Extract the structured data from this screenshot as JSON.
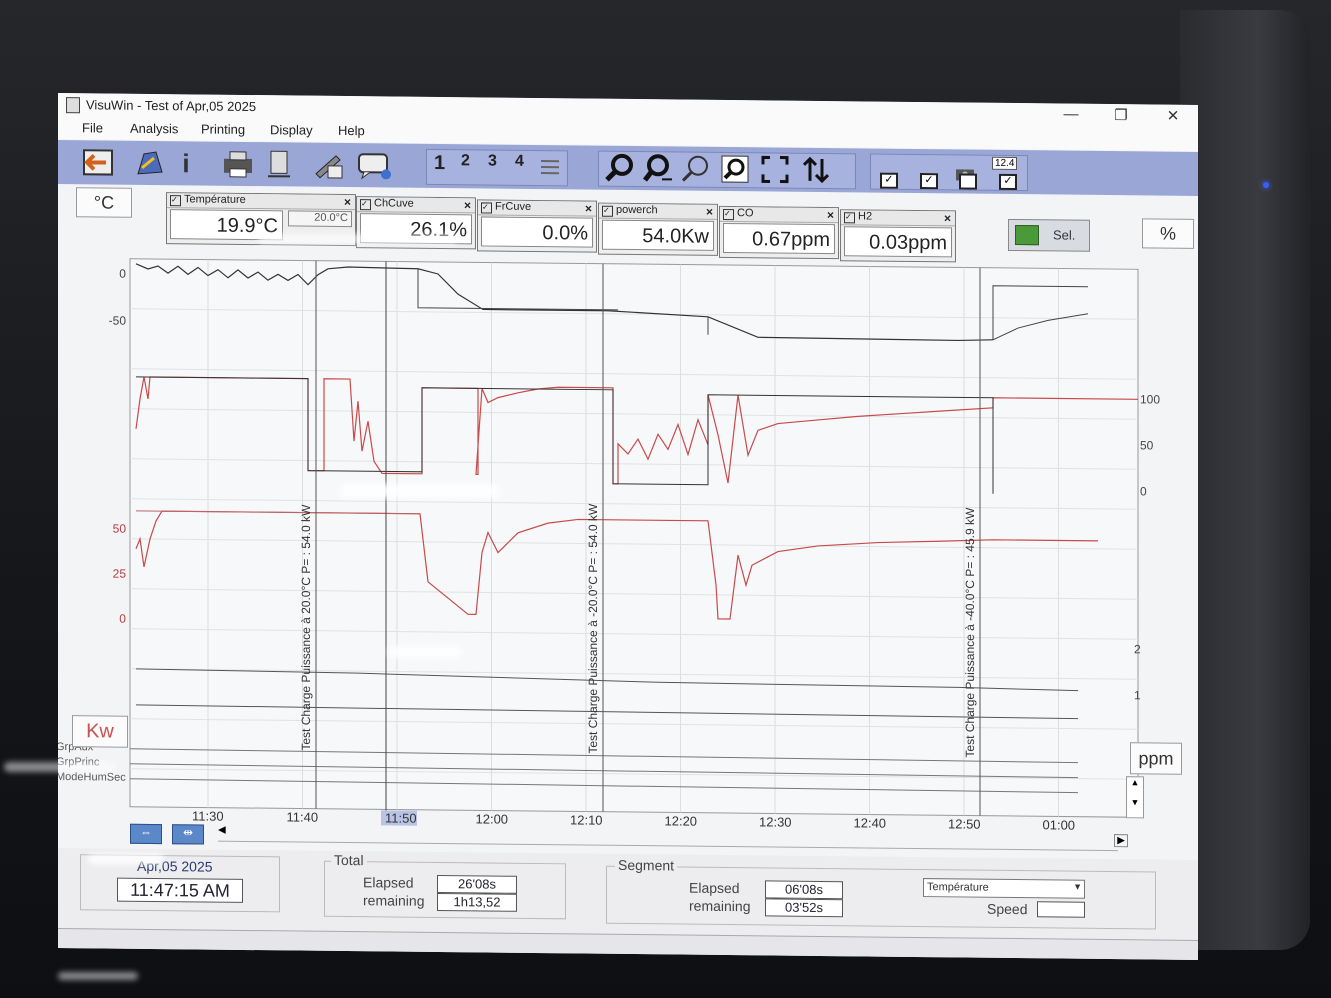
{
  "window": {
    "title": "VisuWin - Test of Apr,05 2025",
    "buttons": {
      "minimize": "—",
      "restore": "❐",
      "close": "✕"
    }
  },
  "menu": [
    "File",
    "Analysis",
    "Printing",
    "Display",
    "Help"
  ],
  "toolbar": {
    "pages": [
      "1",
      "2",
      "3",
      "4"
    ],
    "counter": "12.4",
    "icons": [
      "exit-icon",
      "open-icon",
      "info-icon",
      "print-icon",
      "page-icon",
      "edit-icon",
      "comment-icon",
      "zoom-icon",
      "zoom-out-icon",
      "zoom-in-icon",
      "zoom-window-icon",
      "fit-icon",
      "swap-icon",
      "camera-icon"
    ]
  },
  "units": {
    "left_top": "°C",
    "left_bottom": "Kw",
    "right_top": "%",
    "right_bottom": "ppm"
  },
  "sensors": [
    {
      "name": "Température",
      "value": "19.9°C",
      "setpoint": "20.0°C"
    },
    {
      "name": "ChCuve",
      "value": "26.1%"
    },
    {
      "name": "FrCuve",
      "value": "0.0%"
    },
    {
      "name": "powerch",
      "value": "54.0Kw"
    },
    {
      "name": "CO",
      "value": "0.67ppm"
    },
    {
      "name": "H2",
      "value": "0.03ppm"
    }
  ],
  "sel_button": "Sel.",
  "chart_data": {
    "type": "line",
    "y_ticks_temp": [
      "0",
      "-50"
    ],
    "y_ticks_percent": [
      "100",
      "50",
      "0"
    ],
    "y_ticks_power": [
      "50",
      "25",
      "0"
    ],
    "y_ticks_ppm": [
      "2",
      "1"
    ],
    "row_labels": [
      "GrpAux",
      "GrpPrinc",
      "ModeHumSec"
    ],
    "x_ticks": [
      "11:30",
      "11:40",
      "11:50",
      "12:00",
      "12:10",
      "12:20",
      "12:30",
      "12:40",
      "12:50",
      "01:00"
    ],
    "annotations": [
      "Test Charge Puissance à 20.0°C  P= : 54.0 kW",
      "Test Charge Puissance à -20.0°C  P= : 54.0 kW",
      "Test Charge Puissance à -40.0°C  P= : 45.9 kW"
    ],
    "series": [
      {
        "name": "Température",
        "color": "#333333"
      },
      {
        "name": "ChCuve",
        "color": "#c84a4a"
      },
      {
        "name": "powerch",
        "color": "#c84a4a"
      }
    ]
  },
  "status": {
    "date": "Apr,05 2025",
    "time": "11:47:15 AM",
    "total_label": "Total",
    "segment_label": "Segment",
    "elapsed_label": "Elapsed",
    "remaining_label": "remaining",
    "total_elapsed": "26'08s",
    "total_remaining": "1h13,52",
    "segment_elapsed": "06'08s",
    "segment_remaining": "03'52s",
    "channel_select": "Température",
    "speed_label": "Speed",
    "speed_value": ""
  }
}
